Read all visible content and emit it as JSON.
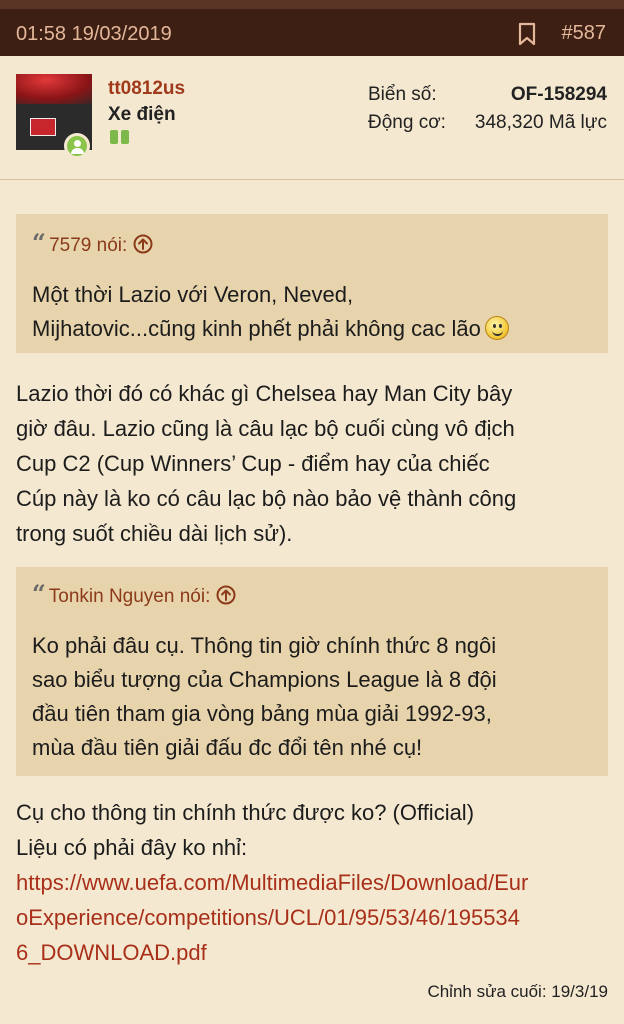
{
  "header": {
    "datetime": "01:58 19/03/2019",
    "post_number": "#587"
  },
  "user": {
    "username": "tt0812us",
    "title": "Xe điện",
    "plate_label": "Biển số:",
    "plate_value": "OF-158294",
    "engine_label": "Động cơ:",
    "engine_value": "348,320 Mã lực"
  },
  "quotes": [
    {
      "author": "7579 nói:",
      "lines": [
        "Một thời Lazio với Veron, Neved,",
        "Mijhatovic...cũng kinh phết phải không cac lão"
      ]
    },
    {
      "author": "Tonkin Nguyen nói:",
      "lines": [
        "Ko phải đâu cụ. Thông tin giờ chính thức 8 ngôi",
        "sao biểu tượng của Champions League là 8 đội",
        "đầu tiên tham gia vòng bảng mùa giải 1992-93,",
        "mùa đầu tiên giải đấu đc đổi tên nhé cụ!"
      ]
    }
  ],
  "reply1": {
    "lines": [
      "Lazio thời đó có khác gì Chelsea hay Man City bây",
      "giờ đâu. Lazio cũng là câu lạc bộ cuối cùng vô địch",
      "Cup C2 (Cup Winners’ Cup - điểm hay của chiếc",
      "Cúp này là ko có câu lạc bộ nào bảo vệ thành công",
      "trong suốt chiều dài lịch sử)."
    ]
  },
  "reply2": {
    "lines": [
      "Cụ cho thông tin chính thức được ko? (Official)",
      "Liệu có phải đây ko nhỉ:"
    ],
    "link_lines": [
      "https://www.uefa.com/MultimediaFiles/Download/Eur",
      "oExperience/competitions/UCL/01/95/53/46/195534",
      "6_DOWNLOAD.pdf"
    ]
  },
  "edited": "Chỉnh sửa cuối: 19/3/19",
  "icons": {
    "bookmark": "bookmark-icon",
    "quote": "quote-icon",
    "jump_up": "jump-to-quote-icon",
    "smiley": "smiley-icon",
    "online": "online-status-icon"
  },
  "colors": {
    "header_bg": "#3e1f13",
    "header_text": "#e3b79a",
    "page_bg": "#f4e8d0",
    "quote_bg": "#e8d4ac",
    "accent": "#a8301a"
  }
}
